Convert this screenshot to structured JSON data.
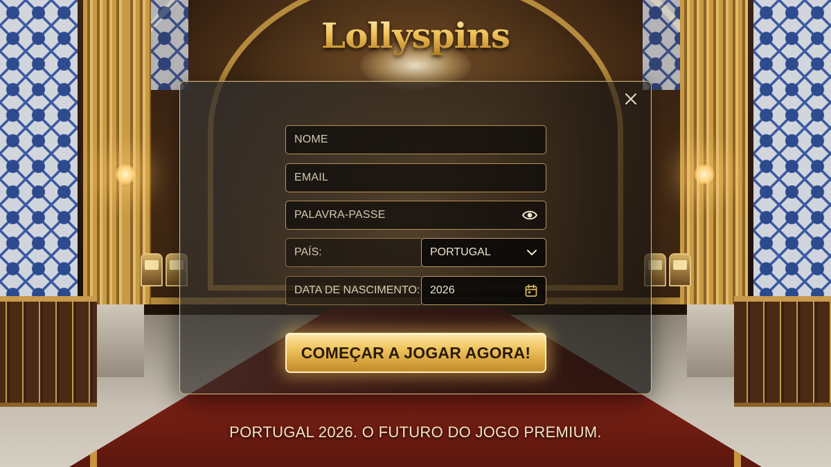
{
  "brand": {
    "logo_text": "Lollyspins",
    "accent": "#e8b84e"
  },
  "modal": {
    "close_icon": "close-icon",
    "name_field": {
      "placeholder": "NOME",
      "value": ""
    },
    "email_field": {
      "placeholder": "EMAIL",
      "value": ""
    },
    "password_field": {
      "placeholder": "PALAVRA-PASSE",
      "value": "",
      "icon": "eye-icon"
    },
    "country": {
      "label": "PAÍS:",
      "selected": "PORTUGAL",
      "icon": "chevron-down-icon"
    },
    "birthdate": {
      "label": "DATA DE NASCIMENTO:",
      "value": "2026",
      "icon": "calendar-icon"
    },
    "submit_label": "COMEÇAR A JOGAR AGORA!"
  },
  "footer": {
    "tagline": "PORTUGAL 2026. O FUTURO DO JOGO PREMIUM."
  }
}
